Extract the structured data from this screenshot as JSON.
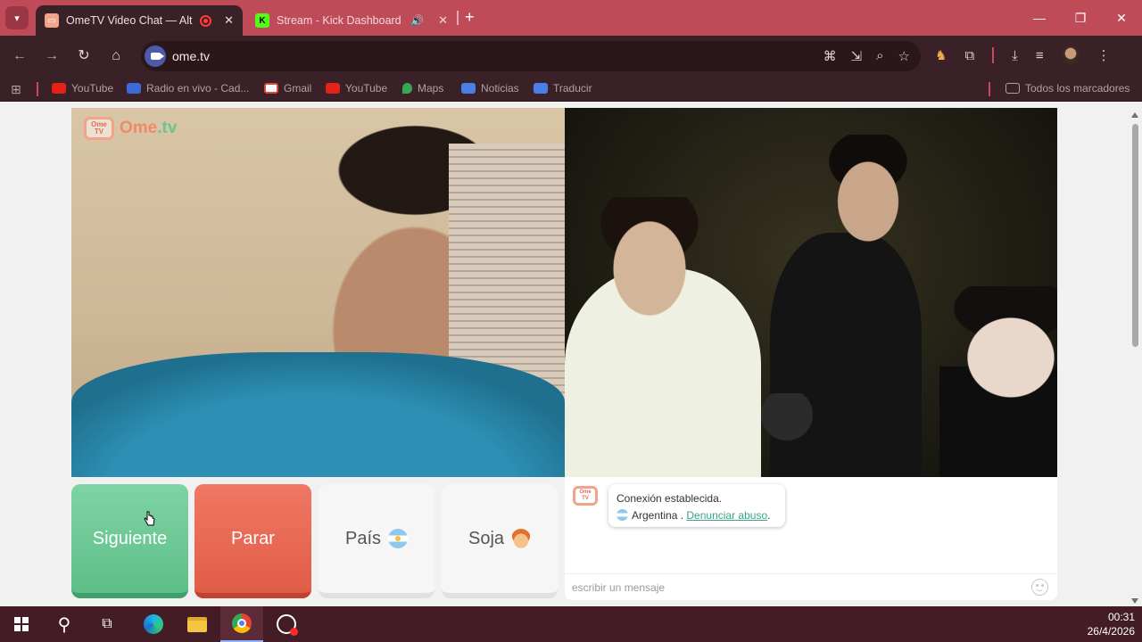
{
  "browser": {
    "tabs": [
      {
        "title": "OmeTV Video Chat — Alternat",
        "active": true,
        "recording": true
      },
      {
        "title": "Stream - Kick Dashboard",
        "active": false,
        "audio": true
      }
    ],
    "url": "ome.tv",
    "bookmarks": [
      {
        "label": "YouTube",
        "icon": "youtube-icon"
      },
      {
        "label": "Radio en vivo - Cad...",
        "icon": "radio-icon"
      },
      {
        "label": "Gmail",
        "icon": "gmail-icon"
      },
      {
        "label": "YouTube",
        "icon": "youtube-icon"
      },
      {
        "label": "Maps",
        "icon": "maps-icon"
      },
      {
        "label": "Noticias",
        "icon": "news-icon"
      },
      {
        "label": "Traducir",
        "icon": "translate-icon"
      }
    ],
    "all_bookmarks_label": "Todos los marcadores"
  },
  "page": {
    "logo": {
      "ome": "Ome",
      "tv": ".tv",
      "icon_text_top": "Ome",
      "icon_text_bottom": "TV"
    },
    "buttons": {
      "next": "Siguiente",
      "stop": "Parar",
      "country": "País",
      "gender": "Soja"
    },
    "chat": {
      "status": "Conexión establecida.",
      "country": "Argentina",
      "separator": " . ",
      "report_link": "Denunciar abuso",
      "input_placeholder": "escribir un mensaje"
    }
  },
  "taskbar": {
    "time": "00:31",
    "date": "26/4/2026"
  },
  "colors": {
    "tabstrip": "#bf4a58",
    "toolbar": "#3a2127",
    "next_button": "#6ccb95",
    "stop_button": "#e8674f",
    "taskbar": "#431c26"
  }
}
